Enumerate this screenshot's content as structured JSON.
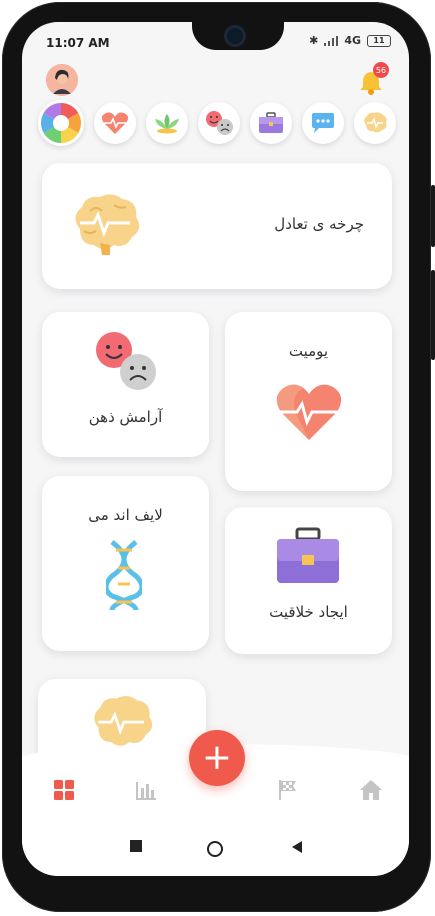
{
  "status_bar": {
    "time": "11:07 AM",
    "network": "4G",
    "battery": "11"
  },
  "header": {
    "notification_count": "56"
  },
  "categories": [
    {
      "name": "balance-wheel"
    },
    {
      "name": "heart"
    },
    {
      "name": "lotus"
    },
    {
      "name": "mood"
    },
    {
      "name": "briefcase"
    },
    {
      "name": "chat"
    },
    {
      "name": "brain"
    }
  ],
  "cards": {
    "balance_wheel": "چرخه ی تعادل",
    "mind_calm": "آرامش ذهن",
    "daily": "یومیت",
    "life_and_me": "لایف اند می",
    "creativity": "ایجاد خلاقیت"
  },
  "colors": {
    "accent": "#f05a4d",
    "heart": "#f16a5a",
    "brain": "#f7d48a",
    "briefcase": "#9b7ae0",
    "dna": "#5bc0e8"
  },
  "bottom_nav": [
    {
      "icon": "grid-icon"
    },
    {
      "icon": "bar-chart-icon"
    },
    {
      "icon": "add-icon",
      "label": "+"
    },
    {
      "icon": "flag-icon"
    },
    {
      "icon": "home-icon"
    }
  ]
}
